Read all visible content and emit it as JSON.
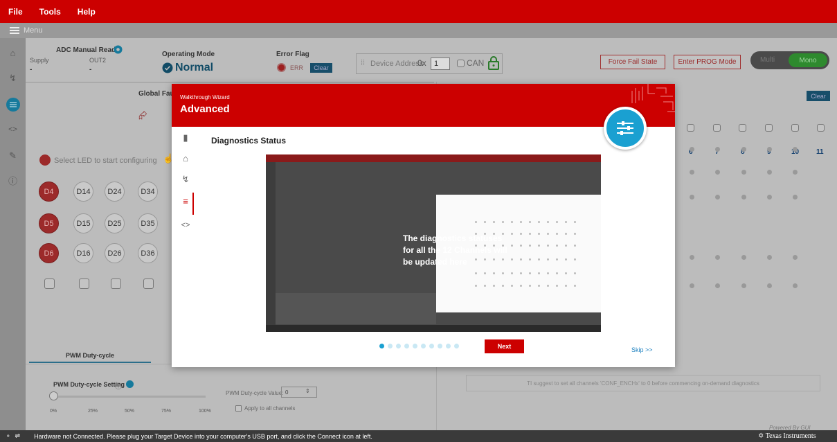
{
  "menubar": {
    "items": [
      "File",
      "Tools",
      "Help"
    ]
  },
  "menu_toggle": {
    "label": "Menu"
  },
  "header": {
    "adc_title": "ADC Manual Read",
    "supply_label": "Supply",
    "out_label": "OUT2",
    "supply_value": "-",
    "out_value": "-",
    "operating_mode_label": "Operating Mode",
    "operating_mode_value": "Normal",
    "error_flag_label": "Error Flag",
    "err_text": "ERR",
    "clear_label": "Clear",
    "device_address_label": "Device Address",
    "device_address_prefix": "0x",
    "device_address_value": "1",
    "can_label": "CAN",
    "force_fail_label": "Force Fail State",
    "enter_prog_label": "Enter PROG Mode",
    "toggle_left": "Multi",
    "toggle_right": "Mono"
  },
  "main": {
    "global_faults_label": "Global Faults",
    "clear_label": "Clear",
    "select_led_hint": "Select LED to start configuring",
    "leds": [
      [
        "D4",
        "D14",
        "D24",
        "D34"
      ],
      [
        "D5",
        "D15",
        "D25",
        "D35"
      ],
      [
        "D6",
        "D16",
        "D26",
        "D36"
      ]
    ],
    "channel_numbers": [
      "6",
      "7",
      "8",
      "9",
      "10",
      "11"
    ],
    "pwm_tab_label": "PWM Duty-cycle",
    "pwm_setting_label": "PWM Duty-cycle Setting",
    "pwm_ticks": [
      "0%",
      "25%",
      "50%",
      "75%",
      "100%"
    ],
    "pwm_value_label": "PWM Duty-cycle Value:",
    "pwm_value": "0",
    "apply_all_label": "Apply to all channels",
    "ondemand_note": "TI suggest to set all channels 'CONF_ENCHx' to 0 before commencing on-demand diagnostics",
    "powered_by": "Powered By GUI Composer"
  },
  "statusbar": {
    "text": "Hardware not Connected.   Please plug your Target Device into your computer's USB port, and click the Connect icon at left.",
    "brand": "Texas Instruments"
  },
  "wizard": {
    "kicker": "Walkthrough Wizard",
    "title": "Advanced",
    "heading": "Diagnostics Status",
    "message": "The diagnostics statuses for all the 12 Channels will be updated here",
    "next_label": "Next",
    "skip_label": "Skip >>",
    "page_count": 10,
    "current_page": 1
  },
  "colors": {
    "ti_red": "#cc0000",
    "accent_blue": "#1aa0d1"
  }
}
